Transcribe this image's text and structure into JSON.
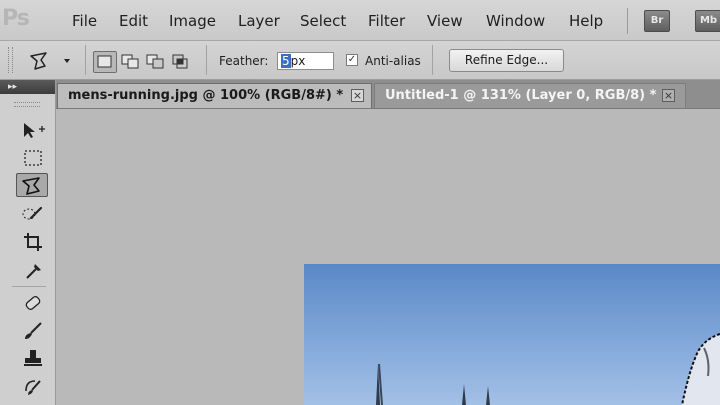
{
  "app": {
    "logo": "Ps"
  },
  "menu": [
    "File",
    "Edit",
    "Image",
    "Layer",
    "Select",
    "Filter",
    "View",
    "Window",
    "Help"
  ],
  "app_buttons": {
    "bridge": "Br",
    "mini_bridge": "Mb"
  },
  "options": {
    "feather_label": "Feather:",
    "feather_value": "5",
    "feather_unit": "px",
    "antialias_label": "Anti-alias",
    "antialias_checked": true,
    "refine_edge_label": "Refine Edge..."
  },
  "tabs": [
    {
      "label": "mens-running.jpg @ 100% (RGB/8#) *",
      "active": true
    },
    {
      "label": "Untitled-1 @ 131% (Layer 0, RGB/8) *",
      "active": false
    }
  ],
  "toolpanel": {
    "collapse_glyph": "▸▸"
  },
  "colors": {
    "sky_top": "#5f8cc8",
    "sky_bottom": "#9bbbe4",
    "selection": "#3a6fc4"
  }
}
